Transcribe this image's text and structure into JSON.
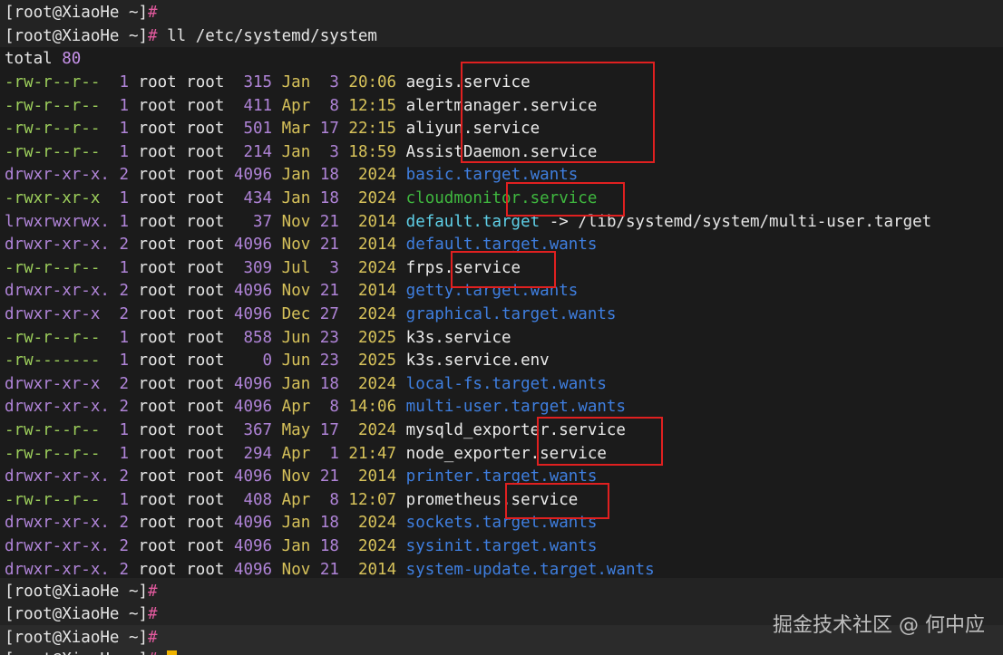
{
  "prompt": "[root@XiaoHe ~]",
  "prompt_symbol": "#",
  "command": "ll /etc/systemd/system",
  "total_label": "total",
  "total_value": "80",
  "entries": [
    {
      "perms": "-rw-r--r--",
      "links": "1",
      "owner": "root",
      "group": "root",
      "size": "315",
      "month": "Jan",
      "day": "3",
      "time": "20:06",
      "name": "aegis.service",
      "type": "file"
    },
    {
      "perms": "-rw-r--r--",
      "links": "1",
      "owner": "root",
      "group": "root",
      "size": "411",
      "month": "Apr",
      "day": "8",
      "time": "12:15",
      "name": "alertmanager.service",
      "type": "file"
    },
    {
      "perms": "-rw-r--r--",
      "links": "1",
      "owner": "root",
      "group": "root",
      "size": "501",
      "month": "Mar",
      "day": "17",
      "time": "22:15",
      "name": "aliyun.service",
      "type": "file"
    },
    {
      "perms": "-rw-r--r--",
      "links": "1",
      "owner": "root",
      "group": "root",
      "size": "214",
      "month": "Jan",
      "day": "3",
      "time": "18:59",
      "name": "AssistDaemon.service",
      "type": "file"
    },
    {
      "perms": "drwxr-xr-x.",
      "links": "2",
      "owner": "root",
      "group": "root",
      "size": "4096",
      "month": "Jan",
      "day": "18",
      "time": "2024",
      "name": "basic.target.wants",
      "type": "dir"
    },
    {
      "perms": "-rwxr-xr-x",
      "links": "1",
      "owner": "root",
      "group": "root",
      "size": "434",
      "month": "Jan",
      "day": "18",
      "time": "2024",
      "name": "cloudmonitor.service",
      "type": "exec"
    },
    {
      "perms": "lrwxrwxrwx.",
      "links": "1",
      "owner": "root",
      "group": "root",
      "size": "37",
      "month": "Nov",
      "day": "21",
      "time": "2014",
      "name": "default.target",
      "type": "link",
      "arrow": "->",
      "target": "/lib/systemd/system/multi-user.target"
    },
    {
      "perms": "drwxr-xr-x.",
      "links": "2",
      "owner": "root",
      "group": "root",
      "size": "4096",
      "month": "Nov",
      "day": "21",
      "time": "2014",
      "name": "default.target.wants",
      "type": "dir"
    },
    {
      "perms": "-rw-r--r--",
      "links": "1",
      "owner": "root",
      "group": "root",
      "size": "309",
      "month": "Jul",
      "day": "3",
      "time": "2024",
      "name": "frps.service",
      "type": "file"
    },
    {
      "perms": "drwxr-xr-x.",
      "links": "2",
      "owner": "root",
      "group": "root",
      "size": "4096",
      "month": "Nov",
      "day": "21",
      "time": "2014",
      "name": "getty.target.wants",
      "type": "dir"
    },
    {
      "perms": "drwxr-xr-x",
      "links": "2",
      "owner": "root",
      "group": "root",
      "size": "4096",
      "month": "Dec",
      "day": "27",
      "time": "2024",
      "name": "graphical.target.wants",
      "type": "dir"
    },
    {
      "perms": "-rw-r--r--",
      "links": "1",
      "owner": "root",
      "group": "root",
      "size": "858",
      "month": "Jun",
      "day": "23",
      "time": "2025",
      "name": "k3s.service",
      "type": "file"
    },
    {
      "perms": "-rw-------",
      "links": "1",
      "owner": "root",
      "group": "root",
      "size": "0",
      "month": "Jun",
      "day": "23",
      "time": "2025",
      "name": "k3s.service.env",
      "type": "file"
    },
    {
      "perms": "drwxr-xr-x",
      "links": "2",
      "owner": "root",
      "group": "root",
      "size": "4096",
      "month": "Jan",
      "day": "18",
      "time": "2024",
      "name": "local-fs.target.wants",
      "type": "dir"
    },
    {
      "perms": "drwxr-xr-x.",
      "links": "2",
      "owner": "root",
      "group": "root",
      "size": "4096",
      "month": "Apr",
      "day": "8",
      "time": "14:06",
      "name": "multi-user.target.wants",
      "type": "dir"
    },
    {
      "perms": "-rw-r--r--",
      "links": "1",
      "owner": "root",
      "group": "root",
      "size": "367",
      "month": "May",
      "day": "17",
      "time": "2024",
      "name": "mysqld_exporter.service",
      "type": "file"
    },
    {
      "perms": "-rw-r--r--",
      "links": "1",
      "owner": "root",
      "group": "root",
      "size": "294",
      "month": "Apr",
      "day": "1",
      "time": "21:47",
      "name": "node_exporter.service",
      "type": "file"
    },
    {
      "perms": "drwxr-xr-x.",
      "links": "2",
      "owner": "root",
      "group": "root",
      "size": "4096",
      "month": "Nov",
      "day": "21",
      "time": "2014",
      "name": "printer.target.wants",
      "type": "dir"
    },
    {
      "perms": "-rw-r--r--",
      "links": "1",
      "owner": "root",
      "group": "root",
      "size": "408",
      "month": "Apr",
      "day": "8",
      "time": "12:07",
      "name": "prometheus.service",
      "type": "file"
    },
    {
      "perms": "drwxr-xr-x.",
      "links": "2",
      "owner": "root",
      "group": "root",
      "size": "4096",
      "month": "Jan",
      "day": "18",
      "time": "2024",
      "name": "sockets.target.wants",
      "type": "dir"
    },
    {
      "perms": "drwxr-xr-x.",
      "links": "2",
      "owner": "root",
      "group": "root",
      "size": "4096",
      "month": "Jan",
      "day": "18",
      "time": "2024",
      "name": "sysinit.target.wants",
      "type": "dir"
    },
    {
      "perms": "drwxr-xr-x.",
      "links": "2",
      "owner": "root",
      "group": "root",
      "size": "4096",
      "month": "Nov",
      "day": "21",
      "time": "2014",
      "name": "system-update.target.wants",
      "type": "dir"
    }
  ],
  "watermark": "掘金技术社区 @ 何中应",
  "colors": {
    "background": "#1e1e1e",
    "highlight_box": "#e02020",
    "cursor": "#f0b400"
  }
}
